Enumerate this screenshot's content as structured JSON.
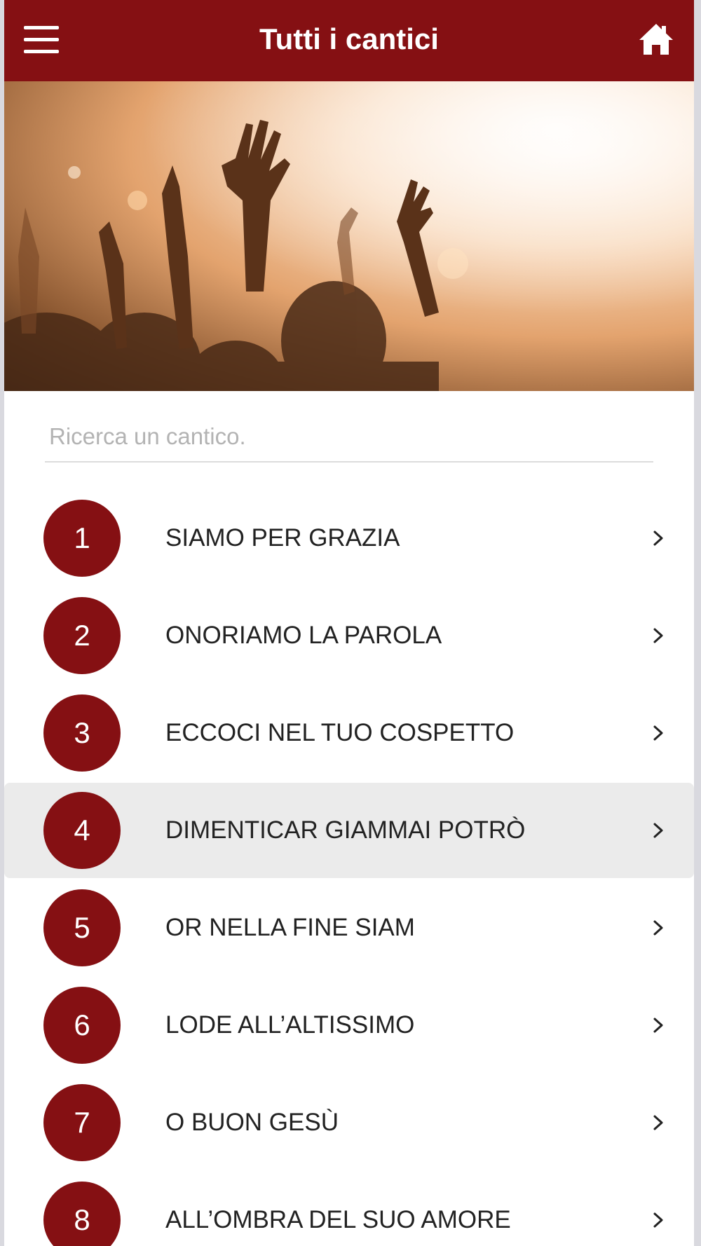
{
  "app": {
    "title": "Tutti i cantici",
    "accent_color": "#851013"
  },
  "header": {
    "menu_icon": "hamburger-menu-icon",
    "home_icon": "home-icon"
  },
  "hero": {
    "description_icon": "worship-raised-hands-photo"
  },
  "search": {
    "placeholder": "Ricerca un cantico.",
    "value": ""
  },
  "songs": [
    {
      "number": "1",
      "title": "SIAMO PER GRAZIA",
      "selected": false
    },
    {
      "number": "2",
      "title": "ONORIAMO LA PAROLA",
      "selected": false
    },
    {
      "number": "3",
      "title": "ECCOCI NEL TUO COSPETTO",
      "selected": false
    },
    {
      "number": "4",
      "title": "DIMENTICAR GIAMMAI POTRÒ",
      "selected": true
    },
    {
      "number": "5",
      "title": "OR NELLA FINE SIAM",
      "selected": false
    },
    {
      "number": "6",
      "title": "LODE ALL’ALTISSIMO",
      "selected": false
    },
    {
      "number": "7",
      "title": "O BUON GESÙ",
      "selected": false
    },
    {
      "number": "8",
      "title": "ALL’OMBRA DEL SUO AMORE",
      "selected": false
    }
  ]
}
